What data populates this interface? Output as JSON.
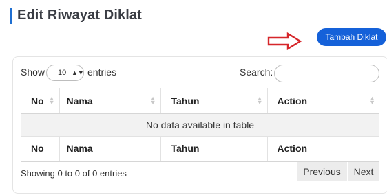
{
  "page": {
    "title": "Edit Riwayat Diklat"
  },
  "actions": {
    "tambah_label": "Tambah Diklat"
  },
  "table_controls": {
    "show_label": "Show",
    "entries_value": "10",
    "entries_label": "entries",
    "search_label": "Search:",
    "search_value": ""
  },
  "table": {
    "headers": [
      "No",
      "Nama",
      "Tahun",
      "Action"
    ],
    "empty_message": "No data available in table",
    "footers": [
      "No",
      "Nama",
      "Tahun",
      "Action"
    ]
  },
  "footer": {
    "info": "Showing 0 to 0 of 0 entries",
    "previous_label": "Previous",
    "next_label": "Next"
  },
  "colors": {
    "accent": "#1561d9",
    "annotation_arrow": "#d6262a"
  }
}
